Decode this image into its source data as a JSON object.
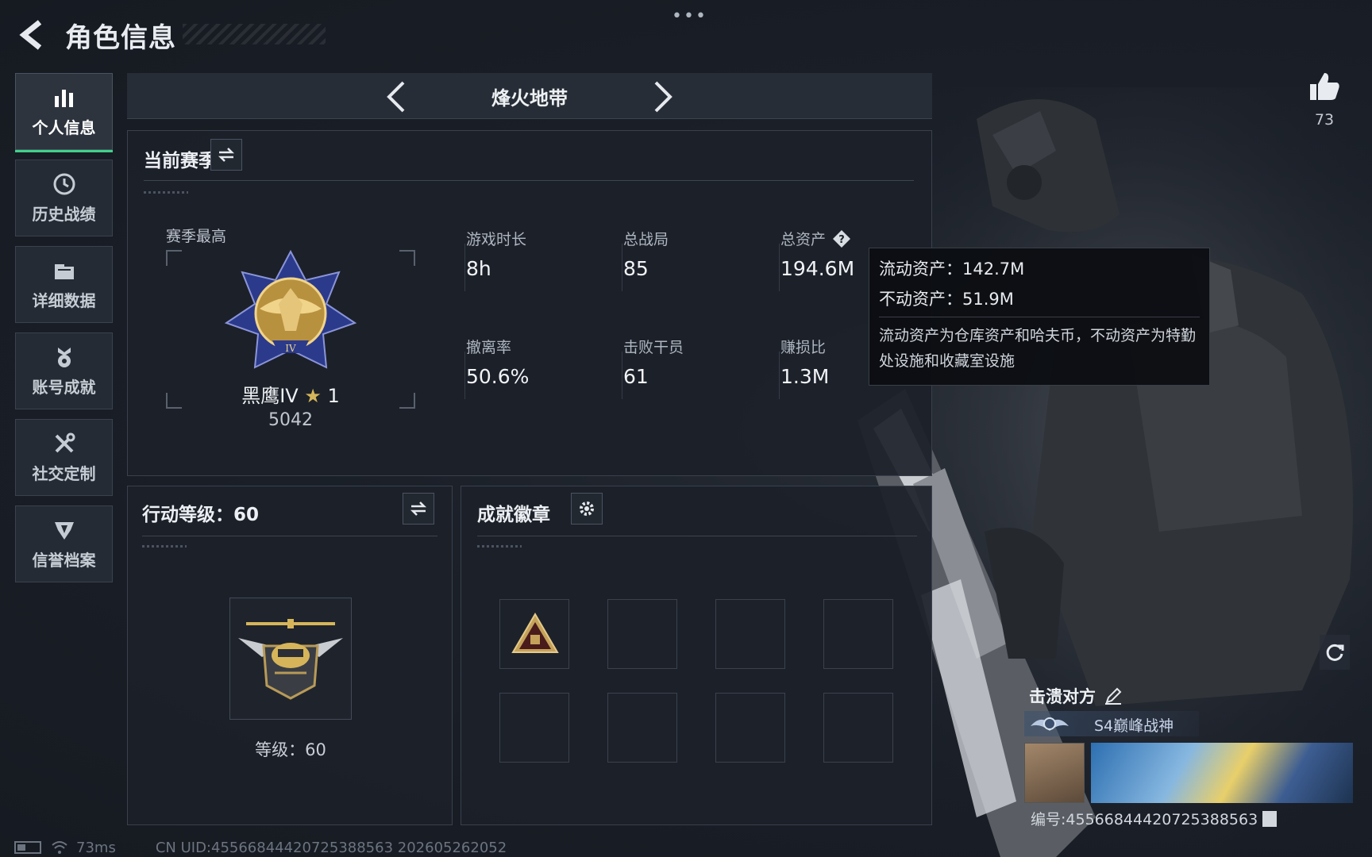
{
  "header": {
    "title": "角色信息",
    "more": "•••"
  },
  "sidebar": {
    "items": [
      {
        "label": "个人信息",
        "icon": "bar-chart-icon",
        "active": true
      },
      {
        "label": "历史战绩",
        "icon": "clock-icon",
        "active": false
      },
      {
        "label": "详细数据",
        "icon": "folder-icon",
        "active": false
      },
      {
        "label": "账号成就",
        "icon": "medal-icon",
        "active": false
      },
      {
        "label": "社交定制",
        "icon": "tools-icon",
        "active": false
      },
      {
        "label": "信誉档案",
        "icon": "shield-badge-icon",
        "active": false
      }
    ]
  },
  "mode": {
    "title": "烽火地带"
  },
  "season": {
    "title": "当前赛季",
    "best_label": "赛季最高",
    "rank_name": "黑鹰IV",
    "rank_stars": "1",
    "rank_score": "5042",
    "stats": [
      {
        "label": "游戏时长",
        "value": "8h"
      },
      {
        "label": "总战局",
        "value": "85"
      },
      {
        "label": "总资产",
        "value": "194.6M"
      },
      {
        "label": "撤离率",
        "value": "50.6%"
      },
      {
        "label": "击败干员",
        "value": "61"
      },
      {
        "label": "赚损比",
        "value": "1.3M"
      }
    ]
  },
  "tooltip": {
    "liquid": "流动资产：142.7M",
    "fixed": "不动资产：51.9M",
    "desc": "流动资产为仓库资产和哈夫币，不动资产为特勤处设施和收藏室设施"
  },
  "level": {
    "title": "行动等级：60",
    "text": "等级：60"
  },
  "achievements": {
    "title": "成就徽章"
  },
  "profile": {
    "likes": "73",
    "card_title": "击溃对方",
    "badge_title": "S4巅峰战神",
    "uid": "编号:45566844420725388563"
  },
  "status": {
    "ping": "73ms",
    "uid_line": "CN UID:45566844420725388563 202605262052"
  },
  "colors": {
    "accent": "#3ed28a",
    "background": "#1a1f28",
    "panel": "#1c2129"
  }
}
